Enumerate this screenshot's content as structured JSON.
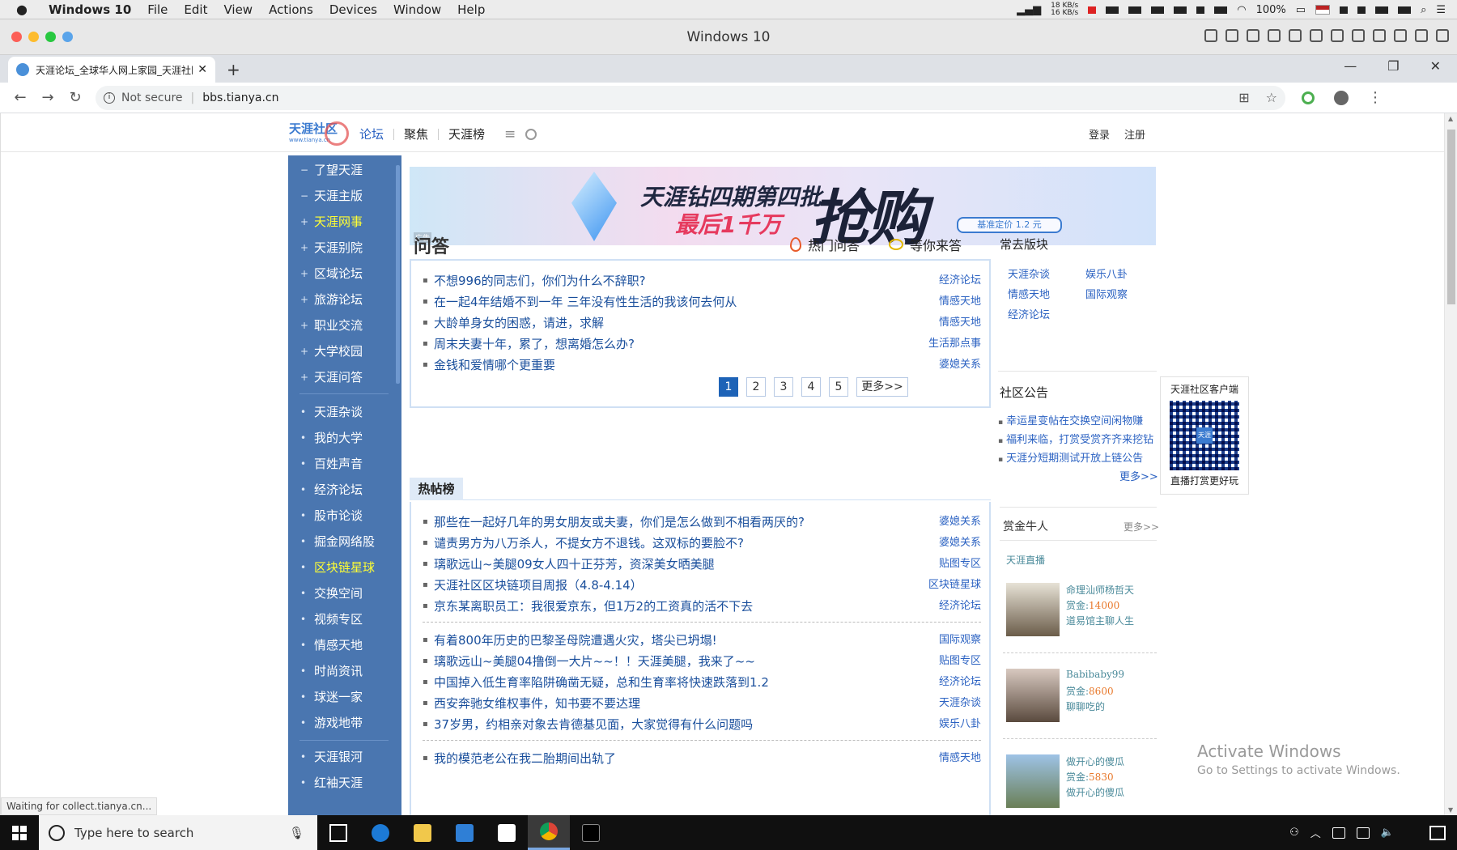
{
  "mac_menubar": {
    "apple": "",
    "app_name": "Windows 10",
    "menus": [
      "File",
      "Edit",
      "View",
      "Actions",
      "Devices",
      "Window",
      "Help"
    ],
    "net_up": "18 KB/s",
    "net_down": "16 KB/s",
    "battery": "100%"
  },
  "vm_window": {
    "title": "Windows 10"
  },
  "browser": {
    "tab_title": "天涯论坛_全球华人网上家园_天涯社区",
    "address_insecure": "Not secure",
    "address_url": "bbs.tianya.cn",
    "status_text": "Waiting for collect.tianya.cn..."
  },
  "header": {
    "logo_text": "天涯社区",
    "logo_sub": "www.tianya.cn",
    "nav": [
      "论坛",
      "聚焦",
      "天涯榜"
    ],
    "login": "登录",
    "register": "注册"
  },
  "sidebar": {
    "group1": [
      {
        "mark": "−",
        "label": "了望天涯"
      },
      {
        "mark": "−",
        "label": "天涯主版"
      },
      {
        "mark": "+",
        "label": "天涯网事",
        "active": true
      },
      {
        "mark": "+",
        "label": "天涯别院"
      },
      {
        "mark": "+",
        "label": "区域论坛"
      },
      {
        "mark": "+",
        "label": "旅游论坛"
      },
      {
        "mark": "+",
        "label": "职业交流"
      },
      {
        "mark": "+",
        "label": "大学校园"
      },
      {
        "mark": "+",
        "label": "天涯问答"
      }
    ],
    "group2": [
      {
        "mark": "•",
        "label": "天涯杂谈"
      },
      {
        "mark": "•",
        "label": "我的大学"
      },
      {
        "mark": "•",
        "label": "百姓声音"
      },
      {
        "mark": "•",
        "label": "经济论坛"
      },
      {
        "mark": "•",
        "label": "股市论谈"
      },
      {
        "mark": "•",
        "label": "掘金网络股"
      },
      {
        "mark": "•",
        "label": "区块链星球",
        "active": true
      },
      {
        "mark": "•",
        "label": "交换空间"
      },
      {
        "mark": "•",
        "label": "视频专区"
      },
      {
        "mark": "•",
        "label": "情感天地"
      },
      {
        "mark": "•",
        "label": "时尚资讯"
      },
      {
        "mark": "•",
        "label": "球迷一家"
      },
      {
        "mark": "•",
        "label": "游戏地带"
      }
    ],
    "group3": [
      {
        "mark": "•",
        "label": "天涯银河"
      },
      {
        "mark": "•",
        "label": "红袖天涯"
      }
    ]
  },
  "banner": {
    "line1": "天涯钻四期第四批",
    "line2": "最后1千万",
    "big": "抢购",
    "price": "基准定价 1.2 元",
    "ad": "广告"
  },
  "wenda": {
    "title": "问答",
    "tab_hot": "热门问答",
    "tab_wait": "等你来答",
    "posts": [
      {
        "title": "不想996的同志们，你们为什么不辞职?",
        "cat": "经济论坛"
      },
      {
        "title": "在一起4年结婚不到一年 三年没有性生活的我该何去何从",
        "cat": "情感天地"
      },
      {
        "title": "大龄单身女的困惑，请进，求解",
        "cat": "情感天地"
      },
      {
        "title": "周末夫妻十年，累了，想离婚怎么办?",
        "cat": "生活那点事"
      },
      {
        "title": "金钱和爱情哪个更重要",
        "cat": "婆媳关系"
      }
    ],
    "pages": [
      "1",
      "2",
      "3",
      "4",
      "5"
    ],
    "more": "更多>>"
  },
  "hot": {
    "tab_label": "热帖榜",
    "group1": [
      {
        "title": "那些在一起好几年的男女朋友或夫妻，你们是怎么做到不相看两厌的?",
        "cat": "婆媳关系"
      },
      {
        "title": "谴责男方为八万杀人，不提女方不退钱。这双标的要脸不?",
        "cat": "婆媳关系"
      },
      {
        "title": "璃歌远山~美腿09女人四十正芬芳，资深美女晒美腿",
        "cat": "贴图专区"
      },
      {
        "title": "天涯社区区块链项目周报（4.8-4.14）",
        "cat": "区块链星球"
      },
      {
        "title": "京东某离职员工：我很爱京东，但1万2的工资真的活不下去",
        "cat": "经济论坛"
      }
    ],
    "group2": [
      {
        "title": "有着800年历史的巴黎圣母院遭遇火灾，塔尖已坍塌!",
        "cat": "国际观察"
      },
      {
        "title": "璃歌远山~美腿04撸倒一大片~~！！天涯美腿，我来了~~",
        "cat": "贴图专区"
      },
      {
        "title": "中国掉入低生育率陷阱确凿无疑，总和生育率将快速跌落到1.2",
        "cat": "经济论坛"
      },
      {
        "title": "西安奔驰女维权事件，知书要不要达理",
        "cat": "天涯杂谈"
      },
      {
        "title": "37岁男，约相亲对象去肯德基见面，大家觉得有什么问题吗",
        "cat": "娱乐八卦"
      }
    ],
    "group3": [
      {
        "title": "我的模范老公在我二胎期间出轨了",
        "cat": "情感天地"
      }
    ]
  },
  "frequent": {
    "title": "常去版块",
    "links": [
      "天涯杂谈",
      "娱乐八卦",
      "情感天地",
      "国际观察",
      "经济论坛"
    ]
  },
  "notice": {
    "title": "社区公告",
    "items": [
      "幸运星变帖在交换空间闲物赚",
      "福利来临，打赏受赏齐齐来挖钻",
      "天涯分短期测试开放上链公告"
    ],
    "more": "更多>>"
  },
  "qr": {
    "top": "天涯社区客户端",
    "center": "天涯",
    "bottom": "直播打赏更好玩"
  },
  "leaderboard": {
    "title": "赏金牛人",
    "more": "更多>>",
    "live": "天涯直播",
    "entries": [
      {
        "name": "命理汕师杨哲天",
        "reward_label": "赏金:",
        "reward": "14000",
        "sub": "道易馆主聊人生"
      },
      {
        "name": "Babibaby99",
        "reward_label": "赏金:",
        "reward": "8600",
        "sub": "聊聊吃的"
      },
      {
        "name": "做开心的傻瓜",
        "reward_label": "赏金:",
        "reward": "5830",
        "sub": "做开心的傻瓜"
      }
    ]
  },
  "activation": {
    "line1": "Activate Windows",
    "line2": "Go to Settings to activate Windows."
  },
  "taskbar": {
    "search_placeholder": "Type here to search"
  },
  "colors": {
    "sidebar_bg": "#4a76b0",
    "sidebar_active": "#ffff33",
    "link_blue": "#1a4f9c",
    "pager_active": "#1e63b7",
    "reward_orange": "#e8782a"
  }
}
